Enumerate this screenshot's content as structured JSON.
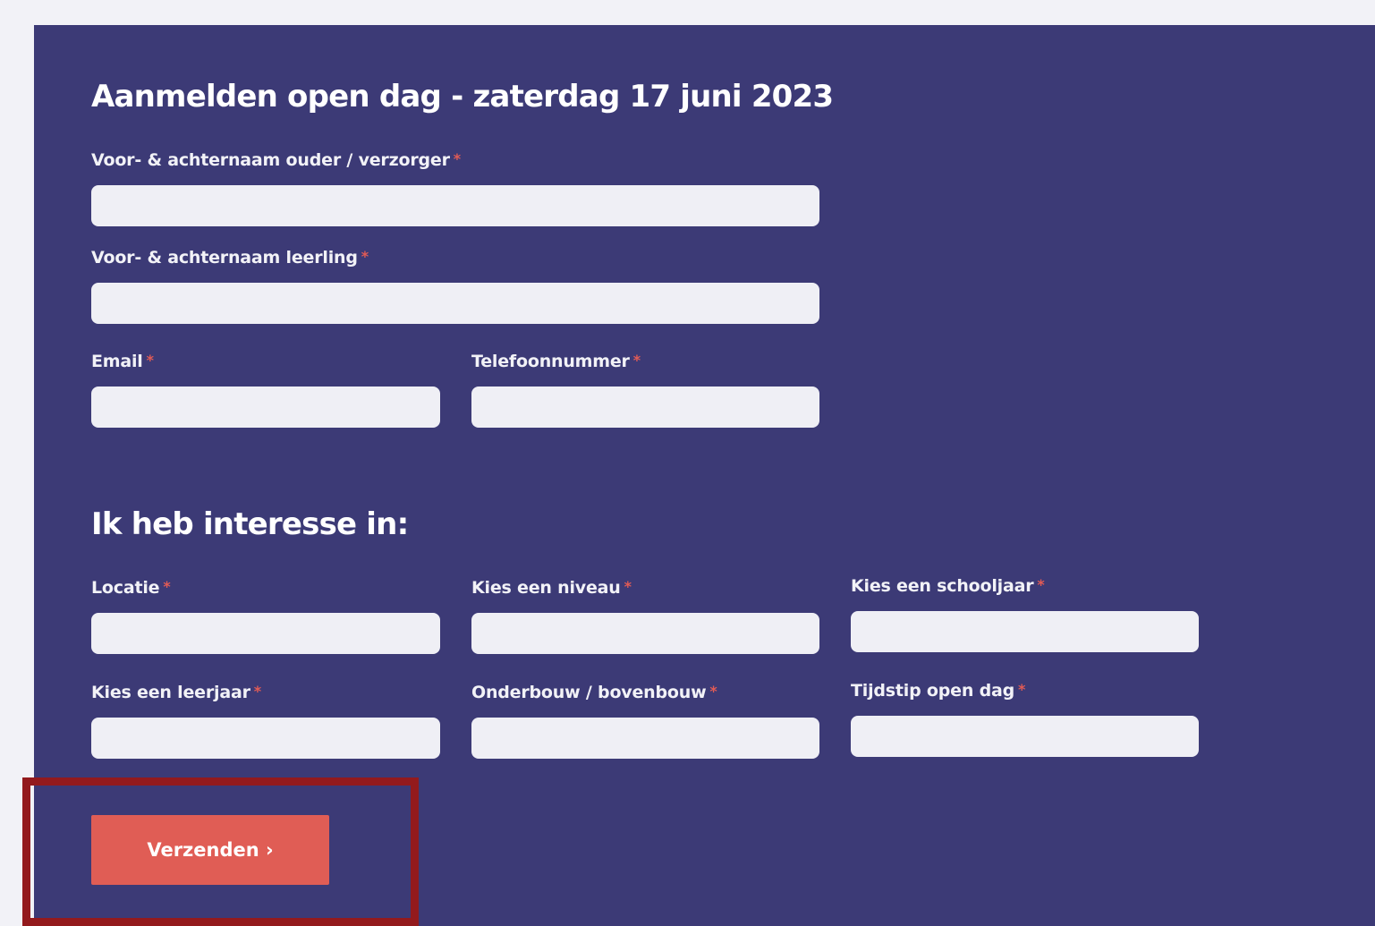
{
  "form": {
    "title": "Aanmelden open dag - zaterdag 17 juni 2023",
    "fields": {
      "parent_name": {
        "label": "Voor- & achternaam ouder / verzorger",
        "value": ""
      },
      "student_name": {
        "label": "Voor- & achternaam leerling",
        "value": ""
      },
      "email": {
        "label": "Email",
        "value": ""
      },
      "phone": {
        "label": "Telefoonnummer",
        "value": ""
      }
    },
    "interest_heading": "Ik heb interesse in:",
    "interest_fields": {
      "location": {
        "label": "Locatie",
        "value": ""
      },
      "level": {
        "label": "Kies een niveau",
        "value": ""
      },
      "school_year": {
        "label": "Kies een schooljaar",
        "value": ""
      },
      "grade": {
        "label": "Kies een leerjaar",
        "value": ""
      },
      "stage": {
        "label": "Onderbouw / bovenbouw",
        "value": ""
      },
      "time": {
        "label": "Tijdstip open dag",
        "value": ""
      }
    },
    "required_marker": "*",
    "submit_label": "Verzenden ›"
  },
  "colors": {
    "page_background": "#f2f2f7",
    "panel_background": "#3c3a76",
    "input_background": "#efeff5",
    "required_marker": "#e25b55",
    "submit_button": "#e05d55",
    "highlight_border": "#931a1d"
  }
}
